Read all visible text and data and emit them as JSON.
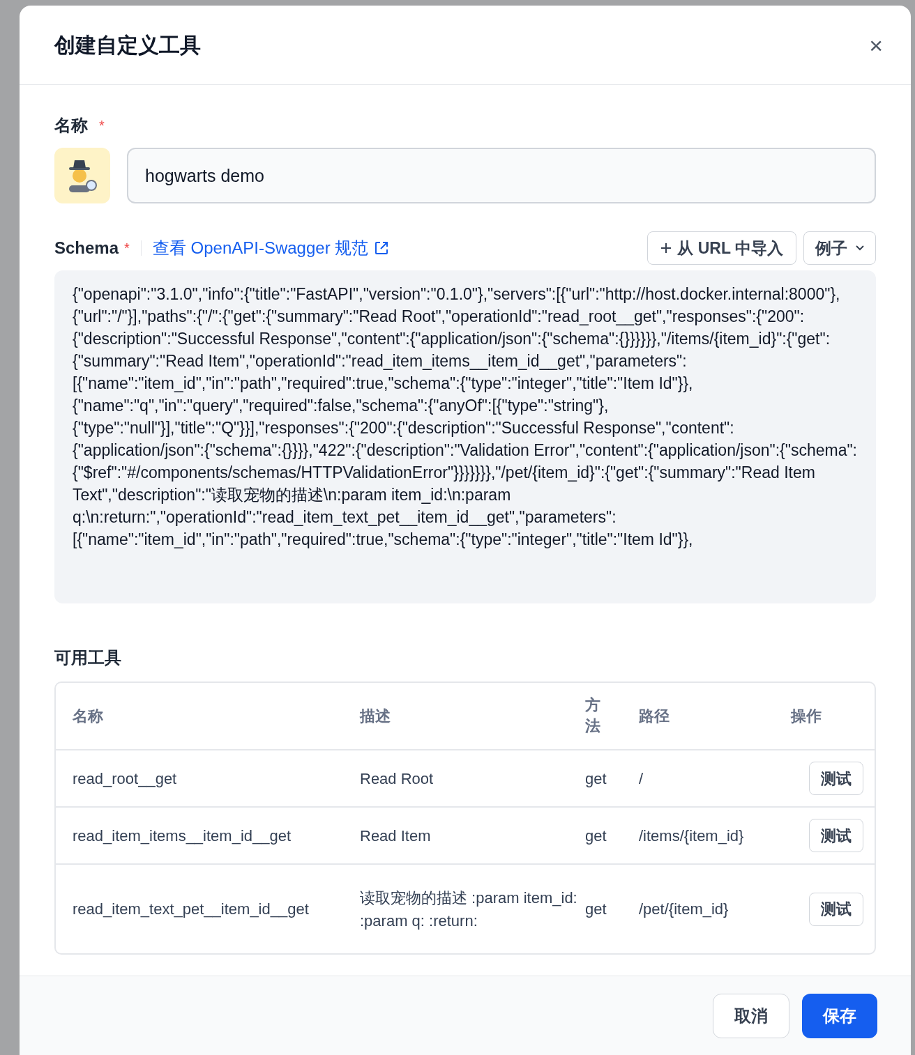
{
  "dialog": {
    "title": "创建自定义工具",
    "close": "×"
  },
  "name_field": {
    "label": "名称",
    "required": "*",
    "value": "hogwarts demo"
  },
  "schema": {
    "label": "Schema",
    "required": "*",
    "link": "查看 OpenAPI-Swagger 规范",
    "import_button": "从 URL 中导入",
    "example_button": "例子",
    "value": "{\"openapi\":\"3.1.0\",\"info\":{\"title\":\"FastAPI\",\"version\":\"0.1.0\"},\"servers\":[{\"url\":\"http://host.docker.internal:8000\"},{\"url\":\"/\"}],\"paths\":{\"/\":{\"get\":{\"summary\":\"Read Root\",\"operationId\":\"read_root__get\",\"responses\":{\"200\":{\"description\":\"Successful Response\",\"content\":{\"application/json\":{\"schema\":{}}}}}},\"/items/{item_id}\":{\"get\":{\"summary\":\"Read Item\",\"operationId\":\"read_item_items__item_id__get\",\"parameters\":[{\"name\":\"item_id\",\"in\":\"path\",\"required\":true,\"schema\":{\"type\":\"integer\",\"title\":\"Item Id\"}},{\"name\":\"q\",\"in\":\"query\",\"required\":false,\"schema\":{\"anyOf\":[{\"type\":\"string\"},{\"type\":\"null\"}],\"title\":\"Q\"}}],\"responses\":{\"200\":{\"description\":\"Successful Response\",\"content\":{\"application/json\":{\"schema\":{}}}},\"422\":{\"description\":\"Validation Error\",\"content\":{\"application/json\":{\"schema\":{\"$ref\":\"#/components/schemas/HTTPValidationError\"}}}}}}},\"/pet/{item_id}\":{\"get\":{\"summary\":\"Read Item Text\",\"description\":\"读取宠物的描述\\n:param item_id:\\n:param q:\\n:return:\",\"operationId\":\"read_item_text_pet__item_id__get\",\"parameters\":[{\"name\":\"item_id\",\"in\":\"path\",\"required\":true,\"schema\":{\"type\":\"integer\",\"title\":\"Item Id\"}},"
  },
  "tools": {
    "title": "可用工具",
    "columns": [
      "名称",
      "描述",
      "方法",
      "路径",
      "操作"
    ],
    "rows": [
      {
        "name": "read_root__get",
        "description": "Read Root",
        "method": "get",
        "path": "/",
        "action": "测试"
      },
      {
        "name": "read_item_items__item_id__get",
        "description": "Read Item",
        "method": "get",
        "path": "/items/{item_id}",
        "action": "测试"
      },
      {
        "name": "read_item_text_pet__item_id__get",
        "description": "读取宠物的描述 :param item_id: :param q: :return:",
        "method": "get",
        "path": "/pet/{item_id}",
        "action": "测试"
      }
    ]
  },
  "footer": {
    "cancel": "取消",
    "save": "保存"
  }
}
